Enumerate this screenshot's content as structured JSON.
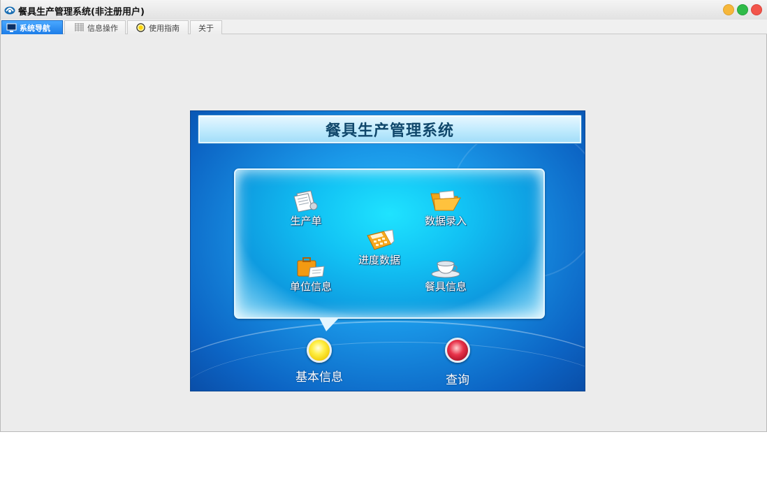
{
  "window": {
    "title": "餐具生产管理系统(非注册用户)",
    "controls": {
      "minimize": "minimize-button",
      "maximize": "maximize-button",
      "close": "close-button"
    },
    "colors": {
      "minimize": "#f6b73a",
      "maximize": "#2fbb48",
      "close": "#f2544a"
    }
  },
  "tabs": [
    {
      "label": "系统导航",
      "icon": "monitor-icon",
      "active": true
    },
    {
      "label": "信息操作",
      "icon": "grid-icon",
      "active": false
    },
    {
      "label": "使用指南",
      "icon": "bulb-icon",
      "active": false
    },
    {
      "label": "关于",
      "icon": "",
      "active": false
    }
  ],
  "panel": {
    "title": "餐具生产管理系统",
    "menu": [
      {
        "label": "生产单",
        "icon": "papers-icon"
      },
      {
        "label": "数据录入",
        "icon": "folder-icon"
      },
      {
        "label": "进度数据",
        "icon": "calculator-icon"
      },
      {
        "label": "单位信息",
        "icon": "briefcase-icon"
      },
      {
        "label": "餐具信息",
        "icon": "teacup-icon"
      }
    ],
    "buttons": [
      {
        "label": "基本信息",
        "color": "#fff04a"
      },
      {
        "label": "查询",
        "color": "#e8334a"
      }
    ]
  }
}
